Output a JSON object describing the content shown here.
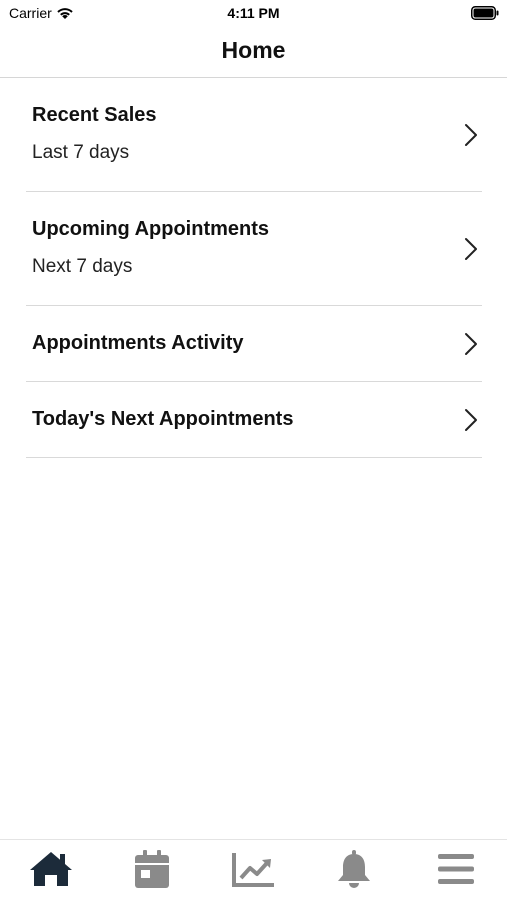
{
  "status_bar": {
    "carrier": "Carrier",
    "time": "4:11 PM"
  },
  "nav": {
    "title": "Home"
  },
  "rows": [
    {
      "title": "Recent Sales",
      "subtitle": "Last 7 days"
    },
    {
      "title": "Upcoming Appointments",
      "subtitle": "Next 7 days"
    },
    {
      "title": "Appointments Activity"
    },
    {
      "title": "Today's Next Appointments"
    }
  ],
  "tab_bar": {
    "tabs": [
      {
        "icon": "home-icon",
        "selected": true
      },
      {
        "icon": "calendar-icon",
        "selected": false
      },
      {
        "icon": "chart-trend-icon",
        "selected": false
      },
      {
        "icon": "bell-icon",
        "selected": false
      },
      {
        "icon": "menu-icon",
        "selected": false
      }
    ]
  },
  "colors": {
    "tab_selected": "#1c2b3a",
    "tab_unselected": "#8a8a8a",
    "separator": "#d9d9d9"
  }
}
